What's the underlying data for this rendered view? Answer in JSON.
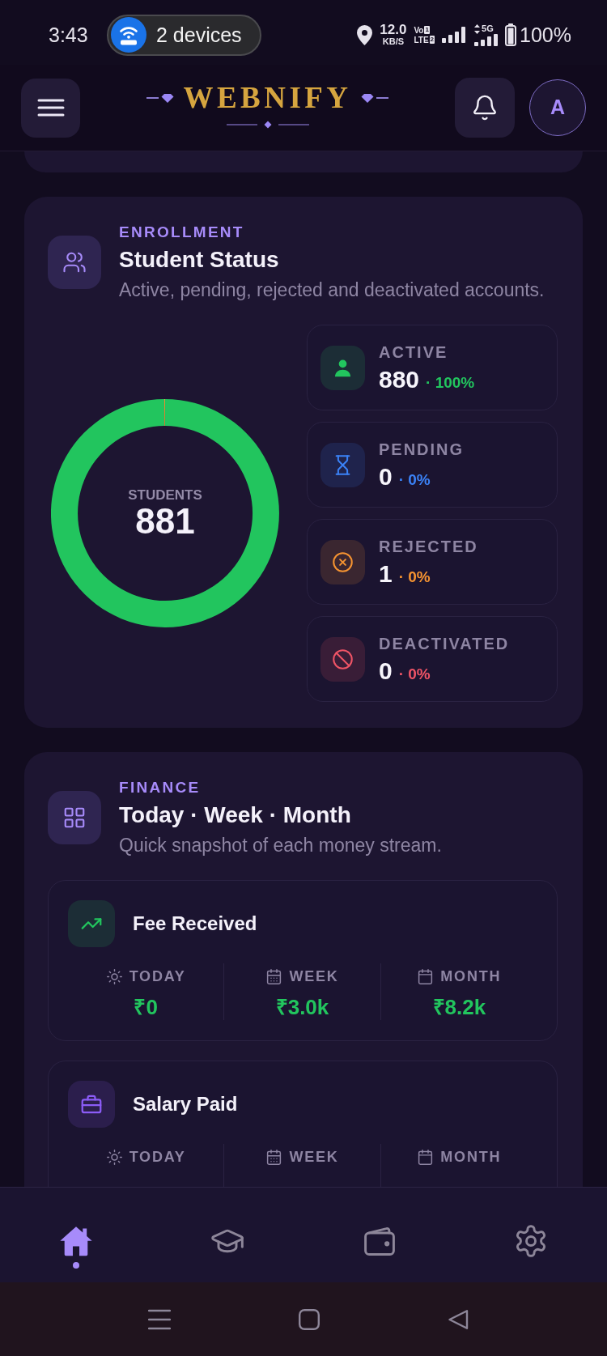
{
  "status_bar": {
    "time": "3:43",
    "hotspot_label": "2 devices",
    "speed_value": "12.0",
    "speed_unit": "KB/S",
    "volte_top": "Vo",
    "volte_top_sim": "1",
    "volte_bottom": "LTE",
    "volte_bottom_sim": "2",
    "network_type": "5G",
    "battery": "100%"
  },
  "header": {
    "logo": "WEBNIFY",
    "avatar_initial": "A"
  },
  "enrollment": {
    "eyebrow": "ENROLLMENT",
    "title": "Student Status",
    "subtitle": "Active, pending, rejected and deactivated accounts.",
    "donut": {
      "center_label": "STUDENTS",
      "center_value": "881",
      "chart_data": {
        "type": "donut",
        "values": [
          99.89,
          0,
          0.11,
          0
        ]
      }
    },
    "stats": [
      {
        "label": "ACTIVE",
        "value": "880",
        "share": "· 100%",
        "color": "#22c55e"
      },
      {
        "label": "PENDING",
        "value": "0",
        "share": "· 0%",
        "color": "#3b82f6"
      },
      {
        "label": "REJECTED",
        "value": "1",
        "share": "· 0%",
        "color": "#f59331"
      },
      {
        "label": "DEACTIVATED",
        "value": "0",
        "share": "· 0%",
        "color": "#ef5466"
      }
    ]
  },
  "finance": {
    "eyebrow": "FINANCE",
    "title": "Today · Week · Month",
    "subtitle": "Quick snapshot of each money stream.",
    "streams": [
      {
        "title": "Fee Received",
        "color": "#22c55e",
        "periods": [
          {
            "label": "TODAY",
            "value": "₹0"
          },
          {
            "label": "WEEK",
            "value": "₹3.0k"
          },
          {
            "label": "MONTH",
            "value": "₹8.2k"
          }
        ]
      },
      {
        "title": "Salary Paid",
        "color": "#8b5cf6",
        "periods": [
          {
            "label": "TODAY"
          },
          {
            "label": "WEEK"
          },
          {
            "label": "MONTH"
          }
        ]
      }
    ]
  },
  "bottom_nav": {
    "items": [
      {
        "selected": true
      },
      {
        "selected": false
      },
      {
        "selected": false
      },
      {
        "selected": false
      }
    ]
  }
}
